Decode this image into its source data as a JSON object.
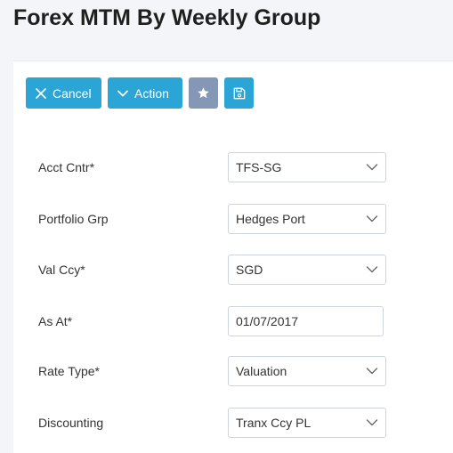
{
  "page": {
    "title": "Forex MTM By Weekly Group"
  },
  "toolbar": {
    "cancel_label": "Cancel",
    "action_label": "Action",
    "cancel_icon": "close-icon",
    "action_icon": "chevron-down-icon",
    "favorite_icon": "star-icon",
    "save_icon": "floppy-disk-icon",
    "primary_color": "#2aa5d6",
    "favorite_color": "#8498b6"
  },
  "form": {
    "fields": [
      {
        "label": "Acct Cntr*",
        "value": "TFS-SG",
        "type": "select"
      },
      {
        "label": "Portfolio Grp",
        "value": "Hedges Port",
        "type": "select"
      },
      {
        "label": "Val Ccy*",
        "value": "SGD",
        "type": "select"
      },
      {
        "label": "As At*",
        "value": "01/07/2017",
        "type": "text"
      },
      {
        "label": "Rate Type*",
        "value": "Valuation",
        "type": "select"
      },
      {
        "label": "Discounting",
        "value": "Tranx Ccy PL",
        "type": "select"
      }
    ]
  }
}
